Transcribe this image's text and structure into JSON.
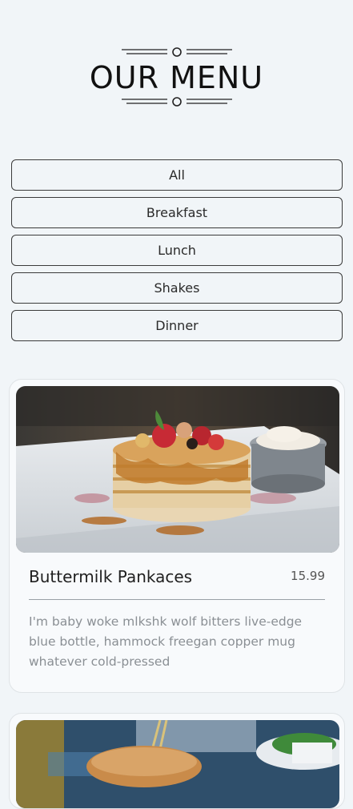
{
  "header": {
    "title": "OUR MENU"
  },
  "filters": [
    "All",
    "Breakfast",
    "Lunch",
    "Shakes",
    "Dinner"
  ],
  "items": [
    {
      "name": "Buttermilk Pankaces",
      "price": "15.99",
      "description": "I'm baby woke mlkshk wolf bitters live-edge blue bottle, hammock freegan copper mug whatever cold-pressed"
    }
  ],
  "colors": {
    "background": "#f1f5f8",
    "card": "#f8fafc",
    "border": "#3b3b3b"
  }
}
